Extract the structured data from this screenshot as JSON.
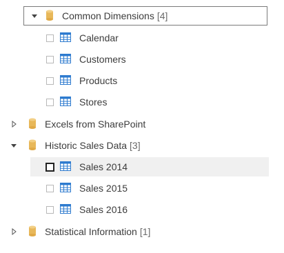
{
  "tree": {
    "folders": [
      {
        "label": "Common Dimensions",
        "count": "[4]",
        "expanded": true,
        "items": [
          {
            "label": "Calendar",
            "checked": false
          },
          {
            "label": "Customers",
            "checked": false
          },
          {
            "label": "Products",
            "checked": false
          },
          {
            "label": "Stores",
            "checked": false
          }
        ]
      },
      {
        "label": "Excels from SharePoint",
        "count": "",
        "expanded": false,
        "items": []
      },
      {
        "label": "Historic Sales Data",
        "count": "[3]",
        "expanded": true,
        "items": [
          {
            "label": "Sales 2014",
            "checked": false
          },
          {
            "label": "Sales 2015",
            "checked": false
          },
          {
            "label": "Sales 2016",
            "checked": false
          }
        ]
      },
      {
        "label": "Statistical Information",
        "count": "[1]",
        "expanded": false,
        "items": []
      }
    ]
  },
  "colors": {
    "db_icon": "#e8b85a",
    "table_icon": "#2e7bcf",
    "selected_row": "#f0f0f0",
    "focus_border": "#7a7a7a"
  },
  "icons": {
    "folder": "database-icon",
    "item": "table-icon",
    "expanded": "triangle-down-icon",
    "collapsed": "triangle-right-icon"
  }
}
